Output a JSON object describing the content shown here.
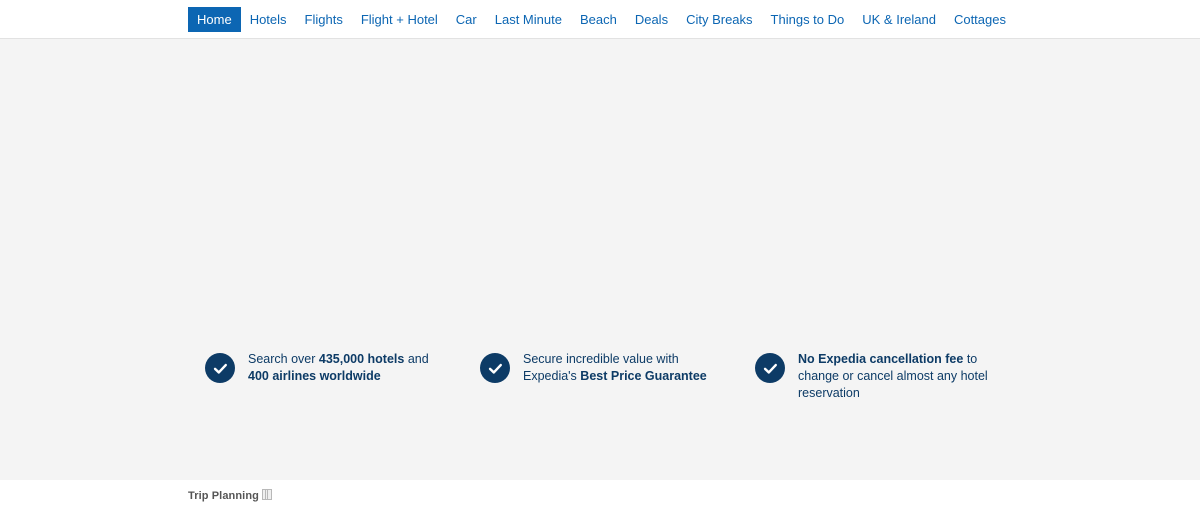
{
  "colors": {
    "nav_link": "#0c66b3",
    "nav_active_bg": "#0c66b3",
    "feature_navy": "#0d3b66",
    "stage_bg": "#f4f4f4",
    "footer_text": "#555555"
  },
  "header": {
    "nav_items": [
      {
        "label": "Home",
        "active": true
      },
      {
        "label": "Hotels",
        "active": false
      },
      {
        "label": "Flights",
        "active": false
      },
      {
        "label": "Flight + Hotel",
        "active": false
      },
      {
        "label": "Car",
        "active": false
      },
      {
        "label": "Last Minute",
        "active": false
      },
      {
        "label": "Beach",
        "active": false
      },
      {
        "label": "Deals",
        "active": false
      },
      {
        "label": "City Breaks",
        "active": false
      },
      {
        "label": "Things to Do",
        "active": false
      },
      {
        "label": "UK & Ireland",
        "active": false
      },
      {
        "label": "Cottages",
        "active": false
      }
    ]
  },
  "features": [
    {
      "icon": "check-circle-icon",
      "parts": [
        {
          "text": "Search over ",
          "bold": false
        },
        {
          "text": "435,000 hotels",
          "bold": true
        },
        {
          "text": " and ",
          "bold": false
        },
        {
          "text": "400 airlines worldwide",
          "bold": true
        }
      ]
    },
    {
      "icon": "check-circle-icon",
      "parts": [
        {
          "text": "Secure incredible value with Expedia's ",
          "bold": false
        },
        {
          "text": "Best Price Guarantee",
          "bold": true
        }
      ]
    },
    {
      "icon": "check-circle-icon",
      "parts": [
        {
          "text": "No Expedia cancellation fee",
          "bold": true
        },
        {
          "text": " to change or cancel almost any hotel reservation",
          "bold": false
        }
      ]
    }
  ],
  "footer": {
    "heading": "Trip Planning",
    "heading_glyph": "missing-glyph-box"
  }
}
